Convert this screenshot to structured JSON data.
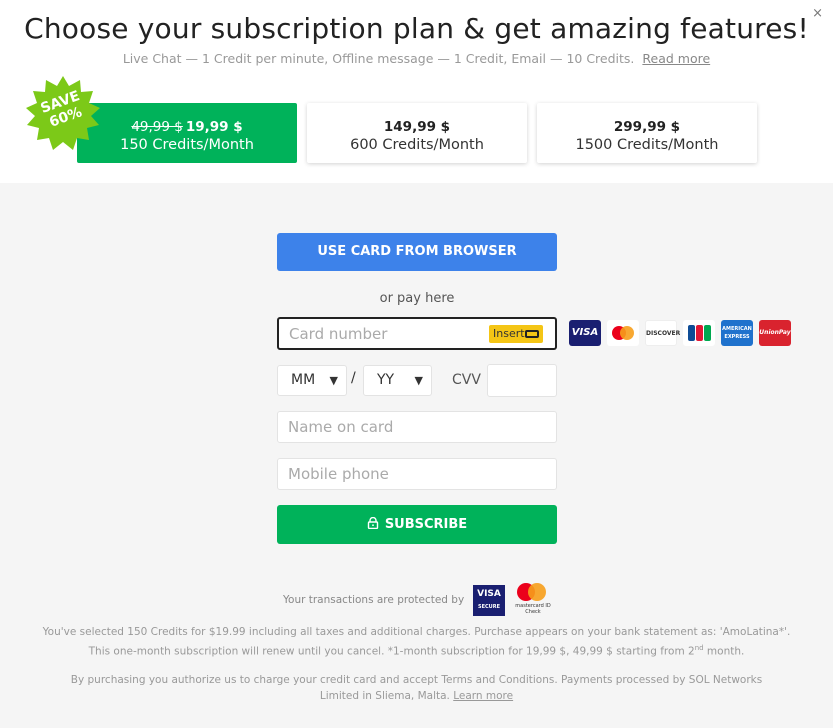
{
  "header": {
    "title": "Choose your subscription plan & get amazing features!",
    "subtitle": "Live Chat — 1 Credit per minute, Offline message — 1 Credit, Email — 10 Credits.",
    "read_more": "Read more",
    "close": "×"
  },
  "badge": {
    "line1": "SAVE",
    "line2": "60%",
    "color": "#7cc918"
  },
  "plans": [
    {
      "old_price": "49,99 $",
      "price": "19,99 $",
      "credits": "150 Credits/Month",
      "selected": true
    },
    {
      "old_price": "",
      "price": "149,99 $",
      "credits": "600 Credits/Month",
      "selected": false
    },
    {
      "old_price": "",
      "price": "299,99 $",
      "credits": "1500 Credits/Month",
      "selected": false
    }
  ],
  "payment": {
    "browser_button": "USE CARD FROM BROWSER",
    "or_text": "or pay here",
    "card_placeholder": "Card number",
    "insert_label": "Insert",
    "month_value": "MM",
    "year_value": "YY",
    "slash": "/",
    "cvv_label": "CVV",
    "name_placeholder": "Name on card",
    "phone_placeholder": "Mobile phone",
    "subscribe_button": "SUBSCRIBE",
    "card_logos": [
      "VISA",
      "Mastercard",
      "DISCOVER",
      "JCB",
      "AMERICAN EXPRESS",
      "UnionPay"
    ]
  },
  "footer": {
    "protected_text": "Your transactions are protected by",
    "visa_secure": "VISA",
    "visa_secure_sub": "SECURE",
    "mc_check": "mastercard ID Check",
    "legal_line1": "You've selected 150 Credits for $19.99 including all taxes and additional charges. Purchase appears on your bank statement as: 'AmoLatina*'.",
    "legal_line2a": "This one-month subscription will renew until you cancel. *1-month subscription for 19,99 $, 49,99 $ starting from 2",
    "legal_line2_sup": "nd",
    "legal_line2b": " month.",
    "legal_line3": "By purchasing you authorize us to charge your credit card and accept Terms and Conditions. Payments processed by SOL Networks",
    "legal_line4": "Limited in  Sliema, Malta.",
    "learn_more": "Learn more"
  },
  "colors": {
    "green": "#00b25a",
    "blue": "#3d82ea",
    "badge": "#7cc918"
  }
}
